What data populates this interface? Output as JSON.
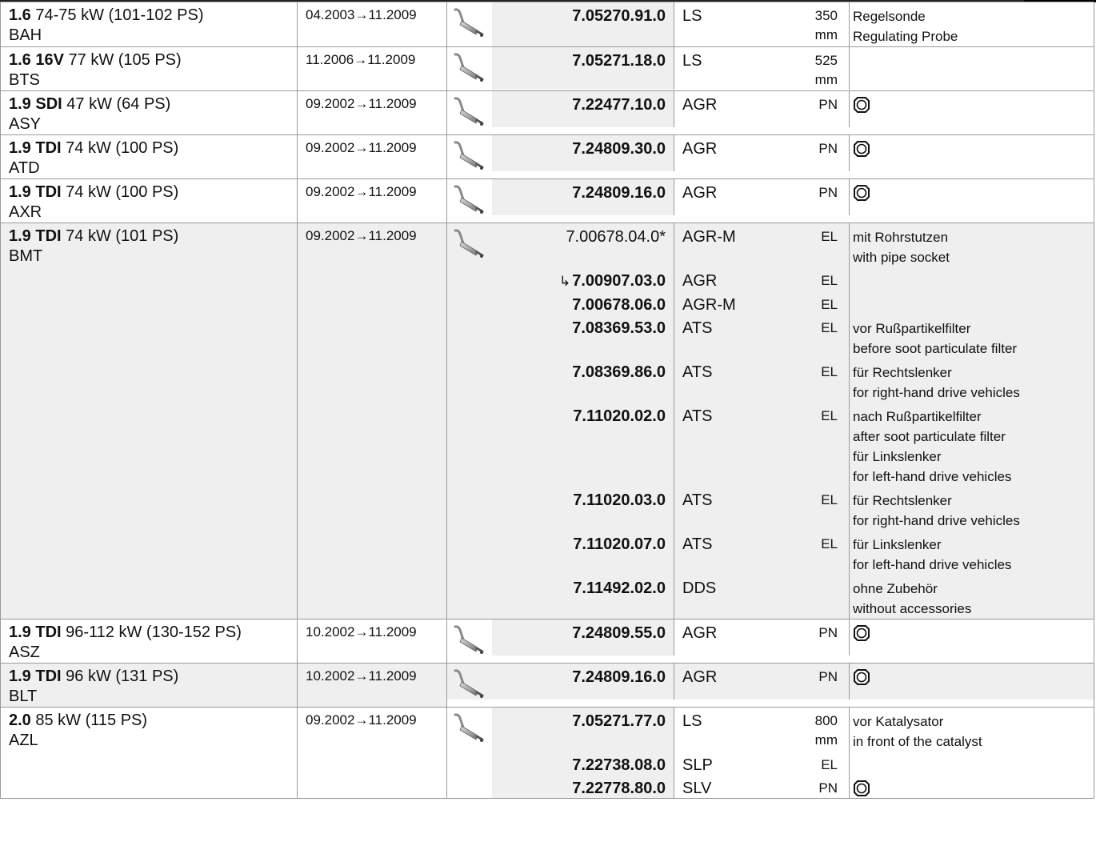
{
  "rows": [
    {
      "model": "1.6",
      "power": "74-75 kW (101-102 PS)",
      "code": "BAH",
      "date": "04.2003→11.2009",
      "shaded": false,
      "parts": [
        {
          "prefix": "",
          "number": "7.05270.91.0",
          "bold": true,
          "type": "LS",
          "unit": "350 mm",
          "notes": [
            "Regelsonde",
            "Regulating Probe"
          ],
          "gasket": false
        }
      ]
    },
    {
      "model": "1.6 16V",
      "power": "77 kW (105 PS)",
      "code": "BTS",
      "date": "11.2006→11.2009",
      "shaded": false,
      "parts": [
        {
          "prefix": "",
          "number": "7.05271.18.0",
          "bold": true,
          "type": "LS",
          "unit": "525 mm",
          "notes": [],
          "gasket": false
        }
      ]
    },
    {
      "model": "1.9 SDI",
      "power": "47 kW (64 PS)",
      "code": "ASY",
      "date": "09.2002→11.2009",
      "shaded": false,
      "parts": [
        {
          "prefix": "",
          "number": "7.22477.10.0",
          "bold": true,
          "type": "AGR",
          "unit": "PN",
          "notes": [],
          "gasket": true
        }
      ]
    },
    {
      "model": "1.9 TDI",
      "power": "74 kW (100 PS)",
      "code": "ATD",
      "date": "09.2002→11.2009",
      "shaded": false,
      "parts": [
        {
          "prefix": "",
          "number": "7.24809.30.0",
          "bold": true,
          "type": "AGR",
          "unit": "PN",
          "notes": [],
          "gasket": true
        }
      ]
    },
    {
      "model": "1.9 TDI",
      "power": "74 kW (100 PS)",
      "code": "AXR",
      "date": "09.2002→11.2009",
      "shaded": false,
      "parts": [
        {
          "prefix": "",
          "number": "7.24809.16.0",
          "bold": true,
          "type": "AGR",
          "unit": "PN",
          "notes": [],
          "gasket": true
        }
      ]
    },
    {
      "model": "1.9 TDI",
      "power": "74 kW (101 PS)",
      "code": "BMT",
      "date": "09.2002→11.2009",
      "shaded": true,
      "parts": [
        {
          "prefix": "",
          "number": "7.00678.04.0*",
          "bold": false,
          "type": "AGR-M",
          "unit": "EL",
          "notes": [
            "mit Rohrstutzen",
            "with pipe socket"
          ],
          "gasket": false
        },
        {
          "prefix": "↳",
          "number": "7.00907.03.0",
          "bold": true,
          "type": "AGR",
          "unit": "EL",
          "notes": [],
          "gasket": false
        },
        {
          "prefix": "",
          "number": "7.00678.06.0",
          "bold": true,
          "type": "AGR-M",
          "unit": "EL",
          "notes": [],
          "gasket": false
        },
        {
          "prefix": "",
          "number": "7.08369.53.0",
          "bold": true,
          "type": "ATS",
          "unit": "EL",
          "notes": [
            "vor Rußpartikelfilter",
            "before soot particulate filter"
          ],
          "gasket": false
        },
        {
          "prefix": "",
          "number": "7.08369.86.0",
          "bold": true,
          "type": "ATS",
          "unit": "EL",
          "notes": [
            "für Rechtslenker",
            "for right-hand drive vehicles"
          ],
          "gasket": false
        },
        {
          "prefix": "",
          "number": "7.11020.02.0",
          "bold": true,
          "type": "ATS",
          "unit": "EL",
          "notes": [
            "nach Rußpartikelfilter",
            "after soot particulate filter",
            "für Linkslenker",
            "for left-hand drive vehicles"
          ],
          "gasket": false
        },
        {
          "prefix": "",
          "number": "7.11020.03.0",
          "bold": true,
          "type": "ATS",
          "unit": "EL",
          "notes": [
            "für Rechtslenker",
            "for right-hand drive vehicles"
          ],
          "gasket": false
        },
        {
          "prefix": "",
          "number": "7.11020.07.0",
          "bold": true,
          "type": "ATS",
          "unit": "EL",
          "notes": [
            "für Linkslenker",
            "for left-hand drive vehicles"
          ],
          "gasket": false
        },
        {
          "prefix": "",
          "number": "7.11492.02.0",
          "bold": true,
          "type": "DDS",
          "unit": "",
          "notes": [
            "ohne Zubehör",
            "without accessories"
          ],
          "gasket": false
        }
      ]
    },
    {
      "model": "1.9 TDI",
      "power": "96-112 kW (130-152 PS)",
      "code": "ASZ",
      "date": "10.2002→11.2009",
      "shaded": false,
      "parts": [
        {
          "prefix": "",
          "number": "7.24809.55.0",
          "bold": true,
          "type": "AGR",
          "unit": "PN",
          "notes": [],
          "gasket": true
        }
      ]
    },
    {
      "model": "1.9 TDI",
      "power": "96 kW (131 PS)",
      "code": "BLT",
      "date": "10.2002→11.2009",
      "shaded": true,
      "parts": [
        {
          "prefix": "",
          "number": "7.24809.16.0",
          "bold": true,
          "type": "AGR",
          "unit": "PN",
          "notes": [],
          "gasket": true
        }
      ]
    },
    {
      "model": "2.0",
      "power": "85 kW (115 PS)",
      "code": "AZL",
      "date": "09.2002→11.2009",
      "shaded": false,
      "parts": [
        {
          "prefix": "",
          "number": "7.05271.77.0",
          "bold": true,
          "type": "LS",
          "unit": "800 mm",
          "notes": [
            "vor Katalysator",
            "in front of the catalyst"
          ],
          "gasket": false
        },
        {
          "prefix": "",
          "number": "7.22738.08.0",
          "bold": true,
          "type": "SLP",
          "unit": "EL",
          "notes": [],
          "gasket": false
        },
        {
          "prefix": "",
          "number": "7.22778.80.0",
          "bold": true,
          "type": "SLV",
          "unit": "PN",
          "notes": [],
          "gasket": true
        }
      ]
    }
  ],
  "icons": {
    "row_icon": "exhaust-part-icon",
    "gasket_icon": "gasket-ring-icon"
  }
}
